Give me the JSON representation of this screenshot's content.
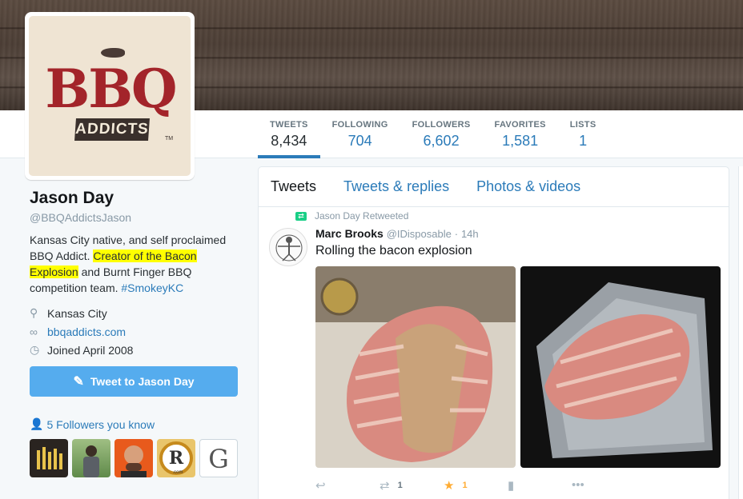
{
  "colors": {
    "accent": "#2b7bb9",
    "tweet_button": "#55acee",
    "highlight": "#ffff00",
    "favorite": "#ffac33",
    "retweet": "#19cf86"
  },
  "avatar": {
    "logo_text": "BBQ",
    "logo_sub": "ADDICTS",
    "tm": "TM"
  },
  "stats": [
    {
      "label": "TWEETS",
      "value": "8,434"
    },
    {
      "label": "FOLLOWING",
      "value": "704"
    },
    {
      "label": "FOLLOWERS",
      "value": "6,602"
    },
    {
      "label": "FAVORITES",
      "value": "1,581"
    },
    {
      "label": "LISTS",
      "value": "1"
    }
  ],
  "profile": {
    "name": "Jason Day",
    "handle": "@BBQAddictsJason",
    "bio_1": "Kansas City native, and self proclaimed BBQ Addict.",
    "bio_hl_1": "Creator of the Bacon",
    "bio_hl_2": "Explosion",
    "bio_2": "and Burnt Finger BBQ competition team.",
    "bio_tag": "#SmokeyKC",
    "location": "Kansas City",
    "website": "bbqaddicts.com",
    "joined": "Joined April 2008",
    "tweet_to": "Tweet to Jason Day",
    "followers_you_know": "5 Followers you know",
    "follower_icons": [
      "bars-logo",
      "person-outdoor",
      "bald-man",
      "r-logo",
      "g-logo"
    ],
    "g_letter": "G",
    "r_letter": "R",
    "r_sub": ".com"
  },
  "timeline": {
    "tabs": [
      "Tweets",
      "Tweets & replies",
      "Photos & videos"
    ],
    "retweet_label": "Jason Day Retweeted",
    "tweet": {
      "name": "Marc Brooks",
      "handle": "@IDisposable",
      "sep": "·",
      "time": "14h",
      "text": "Rolling the bacon explosion",
      "retweets": "1",
      "favorites": "1"
    }
  }
}
